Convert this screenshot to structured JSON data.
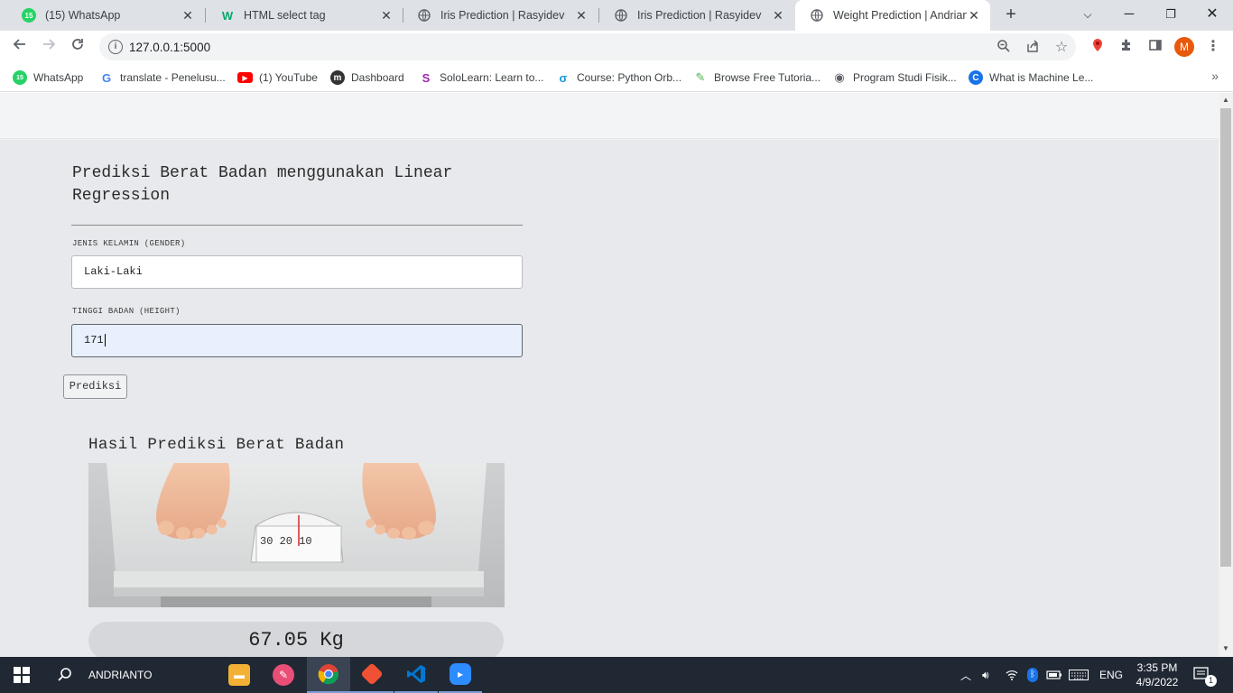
{
  "tabs": [
    {
      "title": "(15) WhatsApp",
      "badge": "15",
      "icon": "whatsapp-icon",
      "color": "#25d366"
    },
    {
      "title": "HTML select tag",
      "badge": "W",
      "icon": "w3schools-icon",
      "color": "#04aa6d"
    },
    {
      "title": "Iris Prediction | Rasyidev",
      "icon": "globe-icon"
    },
    {
      "title": "Iris Prediction | Rasyidev",
      "icon": "globe-icon"
    },
    {
      "title": "Weight Prediction | Andrianto",
      "icon": "globe-icon"
    }
  ],
  "address_bar": {
    "url": "127.0.0.1:5000"
  },
  "bookmarks": [
    {
      "label": "WhatsApp",
      "icon": "whatsapp-icon",
      "glyph": "15",
      "color": "#25d366"
    },
    {
      "label": "translate - Penelusu...",
      "icon": "google-icon",
      "glyph": "G",
      "color": "#ffffff"
    },
    {
      "label": "(1) YouTube",
      "icon": "youtube-icon",
      "glyph": "▶",
      "color": "#ff0000"
    },
    {
      "label": "Dashboard",
      "icon": "dashboard-icon",
      "glyph": "m",
      "color": "#333333"
    },
    {
      "label": "SoloLearn: Learn to...",
      "icon": "sololearn-icon",
      "glyph": "S",
      "color": "#ffffff"
    },
    {
      "label": "Course: Python Orb...",
      "icon": "course-icon",
      "glyph": "σ",
      "color": "#ffffff"
    },
    {
      "label": "Browse Free Tutoria...",
      "icon": "tutorial-icon",
      "glyph": "✎",
      "color": "#ffffff"
    },
    {
      "label": "Program Studi Fisik...",
      "icon": "globe-icon",
      "glyph": "◉",
      "color": "#ffffff"
    },
    {
      "label": "What is Machine Le...",
      "icon": "c-icon",
      "glyph": "C",
      "color": "#1a73e8"
    }
  ],
  "profile": {
    "initial": "M"
  },
  "page": {
    "title": "Prediksi Berat Badan menggunakan Linear Regression",
    "gender_label": "JENIS KELAMIN (GENDER)",
    "gender_value": "Laki-Laki",
    "height_label": "TINGGI BADAN (HEIGHT)",
    "height_value": "171",
    "submit_label": "Prediksi",
    "result_title": "Hasil Prediksi Berat Badan",
    "result_value": "67.05 Kg"
  },
  "taskbar": {
    "search_text": "ANDRIANTO",
    "language": "ENG",
    "time": "3:35 PM",
    "date": "4/9/2022",
    "notification_count": "1"
  },
  "colors": {
    "accent": "#e8590c",
    "page_bg": "#e8e9ec",
    "taskbar": "#202833"
  }
}
